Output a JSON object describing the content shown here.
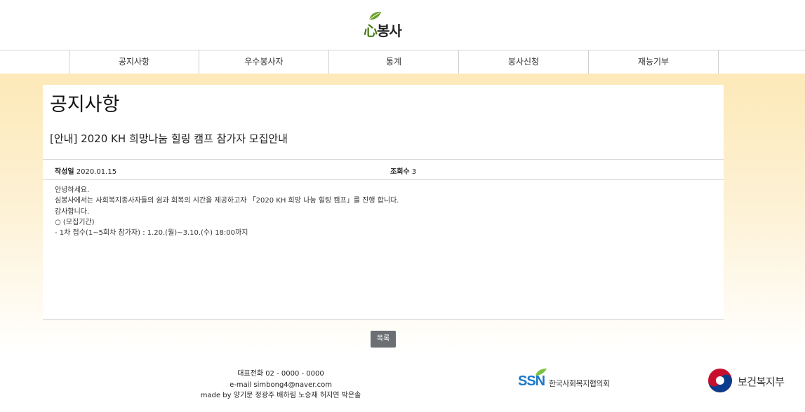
{
  "logo": {
    "heart": "心",
    "text": "봉사"
  },
  "nav": {
    "items": [
      "공지사항",
      "우수봉사자",
      "통계",
      "봉사신청",
      "재능기부"
    ]
  },
  "notice": {
    "page_title": "공지사항",
    "post_title": "[안내] 2020 KH 희망나눔 힐링 캠프 참가자 모집안내",
    "date_label": "작성일",
    "date_value": "2020.01.15",
    "views_label": "조회수",
    "views_value": "3",
    "body_lines": [
      "안녕하세요.",
      "심봉사에서는 사회복지종사자들의 쉼과 회복의 시간을 제공하고자 「2020 KH 희망 나눔 힐링 캠프」를 진행 합니다.",
      "감사합니다.",
      "○ (모집기간)",
      "- 1차 접수(1~5회차 참가자) : 1.20.(월)~3.10.(수) 18:00까지"
    ],
    "list_button": "목록"
  },
  "footer": {
    "phone": "대표전화 02 - 0000 - 0000",
    "email": "e-mail simbong4@naver.com",
    "made_by": "made by 양기문 정광주 배하림 노승재 허지연 박은솔",
    "ssn_mark": "SSN",
    "ssn_name": "한국사회복지협의회",
    "mohw_name": "보건복지부"
  },
  "colors": {
    "accent_green": "#4a7d1e",
    "ssn_blue": "#1e78c8",
    "button_gray": "#6b6f74",
    "gradient_top": "#fde9b8"
  }
}
